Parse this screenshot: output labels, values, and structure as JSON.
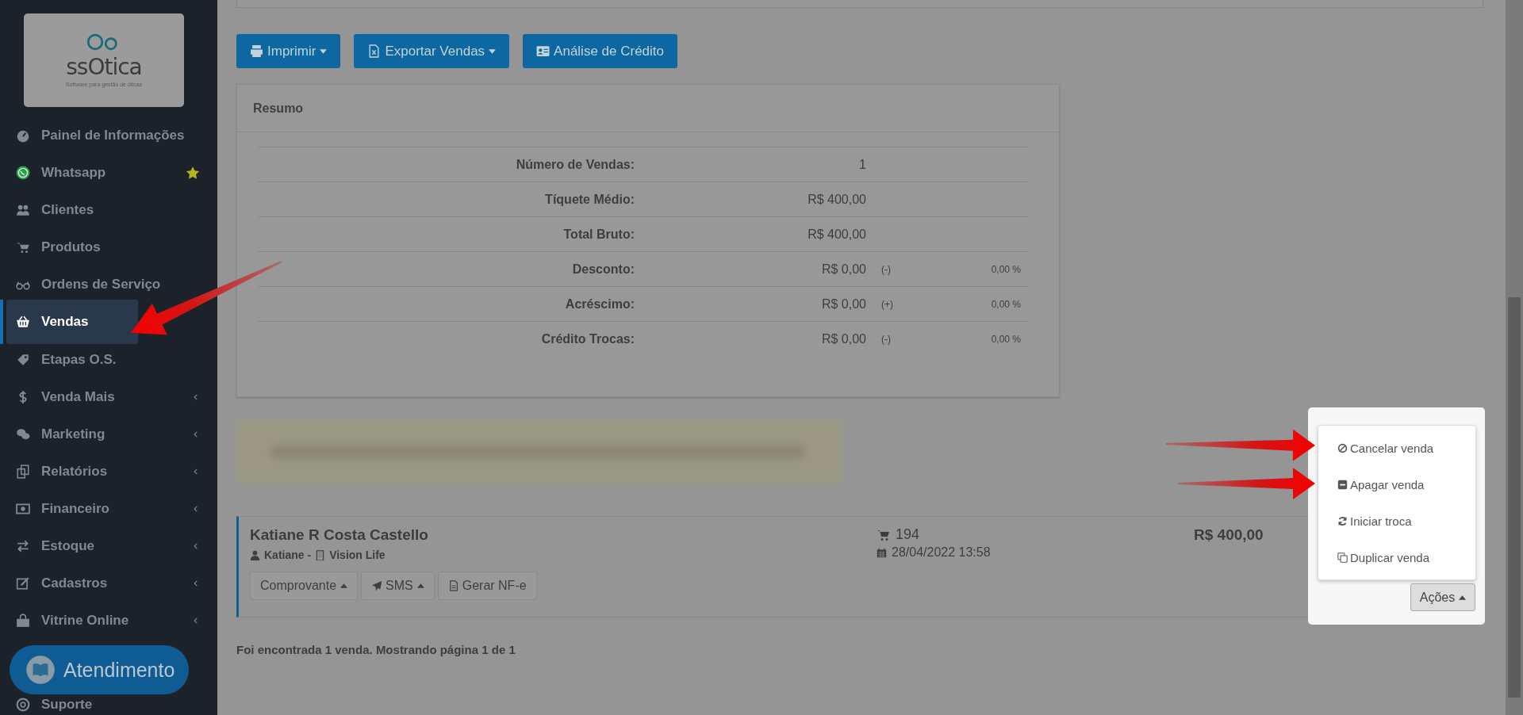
{
  "sidebar": {
    "logo": {
      "name": "ssOtica",
      "tagline": "Software para gestão de óticas"
    },
    "items": [
      {
        "label": "Painel de Informações",
        "selected": false,
        "submenu": false,
        "starred": false
      },
      {
        "label": "Whatsapp",
        "selected": false,
        "submenu": false,
        "starred": true
      },
      {
        "label": "Clientes",
        "selected": false,
        "submenu": false,
        "starred": false
      },
      {
        "label": "Produtos",
        "selected": false,
        "submenu": false,
        "starred": false
      },
      {
        "label": "Ordens de Serviço",
        "selected": false,
        "submenu": false,
        "starred": false
      },
      {
        "label": "Vendas",
        "selected": true,
        "submenu": false,
        "starred": false
      },
      {
        "label": "Etapas O.S.",
        "selected": false,
        "submenu": false,
        "starred": false
      },
      {
        "label": "Venda Mais",
        "selected": false,
        "submenu": true,
        "starred": false
      },
      {
        "label": "Marketing",
        "selected": false,
        "submenu": true,
        "starred": false
      },
      {
        "label": "Relatórios",
        "selected": false,
        "submenu": true,
        "starred": false
      },
      {
        "label": "Financeiro",
        "selected": false,
        "submenu": true,
        "starred": false
      },
      {
        "label": "Estoque",
        "selected": false,
        "submenu": true,
        "starred": false
      },
      {
        "label": "Cadastros",
        "selected": false,
        "submenu": true,
        "starred": false
      },
      {
        "label": "Vitrine Online",
        "selected": false,
        "submenu": true,
        "starred": false
      },
      {
        "label": "Suporte",
        "selected": false,
        "submenu": false,
        "starred": false
      }
    ],
    "help_button": "Atendimento"
  },
  "toolbar": [
    {
      "label": "Imprimir",
      "dropdown": true
    },
    {
      "label": "Exportar Vendas",
      "dropdown": true
    },
    {
      "label": "Análise de Crédito",
      "dropdown": false
    }
  ],
  "summary": {
    "title": "Resumo",
    "rows": [
      {
        "label": "Número de Vendas:",
        "value": "1"
      },
      {
        "label": "Tíquete Médio:",
        "value": "R$ 400,00"
      },
      {
        "label": "Total Bruto:",
        "value": "R$ 400,00"
      },
      {
        "label": "Desconto:",
        "value": "R$ 0,00",
        "sign": "(-)",
        "percent": "0,00 %"
      },
      {
        "label": "Acréscimo:",
        "value": "R$ 0,00",
        "sign": "(+)",
        "percent": "0,00 %"
      },
      {
        "label": "Crédito Trocas:",
        "value": "R$ 0,00",
        "sign": "(-)",
        "percent": "0,00 %"
      }
    ]
  },
  "sale": {
    "customer": "Katiane R Costa Castello",
    "seller": "Katiane -",
    "store": "Vision Life",
    "order": "194",
    "date": "28/04/2022 13:58",
    "total": "R$ 400,00",
    "buttons": [
      "Comprovante",
      "SMS",
      "Gerar NF-e"
    ],
    "actions_button": "Ações",
    "actions_menu": [
      "Cancelar venda",
      "Apagar venda",
      "Iniciar troca",
      "Duplicar venda"
    ]
  },
  "footer": "Foi encontrada 1 venda. Mostrando página 1 de 1"
}
